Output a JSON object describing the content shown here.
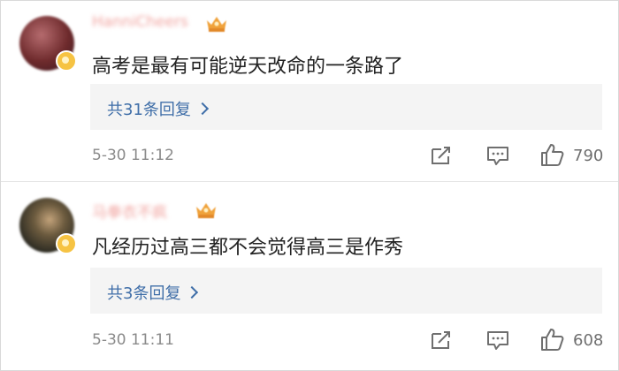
{
  "comments": [
    {
      "username": "HanniCheers",
      "text": "高考是最有可能逆天改命的一条路了",
      "reply_label": "共31条回复",
      "time": "5-30 11:12",
      "likes": "790",
      "avatar_colors": [
        "#6e2a2c",
        "#b56b6e"
      ]
    },
    {
      "username": "马拳衣不疯",
      "text": "凡经历过高三都不会觉得高三是作秀",
      "reply_label": "共3条回复",
      "time": "5-30 11:11",
      "likes": "608",
      "avatar_colors": [
        "#2b2a22",
        "#8c7a55"
      ]
    }
  ],
  "colors": {
    "reply_link": "#3f6ea8",
    "username": "#f1a4a0",
    "time": "#8a8a8a",
    "reply_box_bg": "#f4f4f4"
  },
  "icons": [
    "forward-icon",
    "comment-icon",
    "like-icon",
    "vip-crown-icon",
    "verified-badge-icon",
    "chevron-right-icon"
  ]
}
